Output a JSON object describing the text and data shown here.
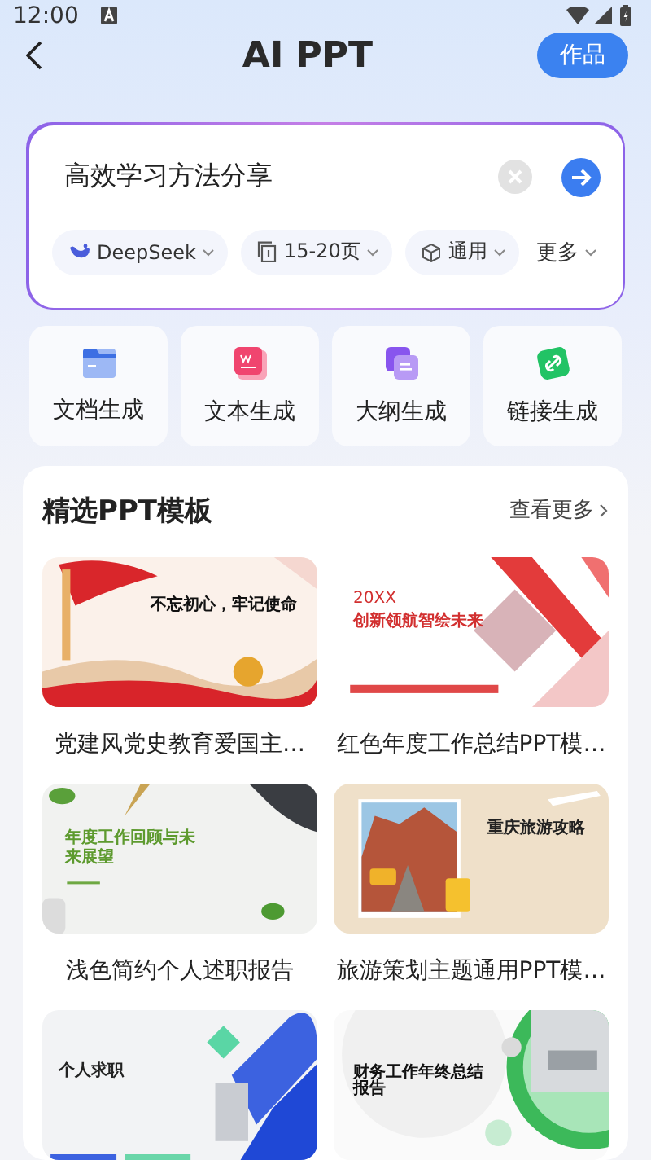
{
  "status_bar": {
    "time": "12:00"
  },
  "header": {
    "title": "AI PPT",
    "action": "作品"
  },
  "prompt": {
    "value": "高效学习方法分享",
    "options": [
      {
        "kind": "model",
        "label": "DeepSeek"
      },
      {
        "kind": "pages",
        "label": "15-20页"
      },
      {
        "kind": "style",
        "label": "通用"
      }
    ],
    "more": "更多"
  },
  "tools": [
    {
      "kind": "document",
      "label": "文档生成"
    },
    {
      "kind": "text",
      "label": "文本生成"
    },
    {
      "kind": "outline",
      "label": "大纲生成"
    },
    {
      "kind": "link",
      "label": "链接生成"
    }
  ],
  "templates": {
    "title": "精选PPT模板",
    "more": "查看更多",
    "items": [
      {
        "slide_title": "不忘初心，牢记使命",
        "name": "党建风党史教育爱国主…"
      },
      {
        "slide_subtitle": "20XX",
        "slide_title": "创新领航智绘未来",
        "name": "红色年度工作总结PPT模…"
      },
      {
        "slide_title": "年度工作回顾与未来展望",
        "name": "浅色简约个人述职报告"
      },
      {
        "slide_title": "重庆旅游攻略",
        "name": "旅游策划主题通用PPT模…"
      },
      {
        "slide_title": "个人求职"
      },
      {
        "slide_title": "财务工作年终总结报告"
      }
    ]
  }
}
